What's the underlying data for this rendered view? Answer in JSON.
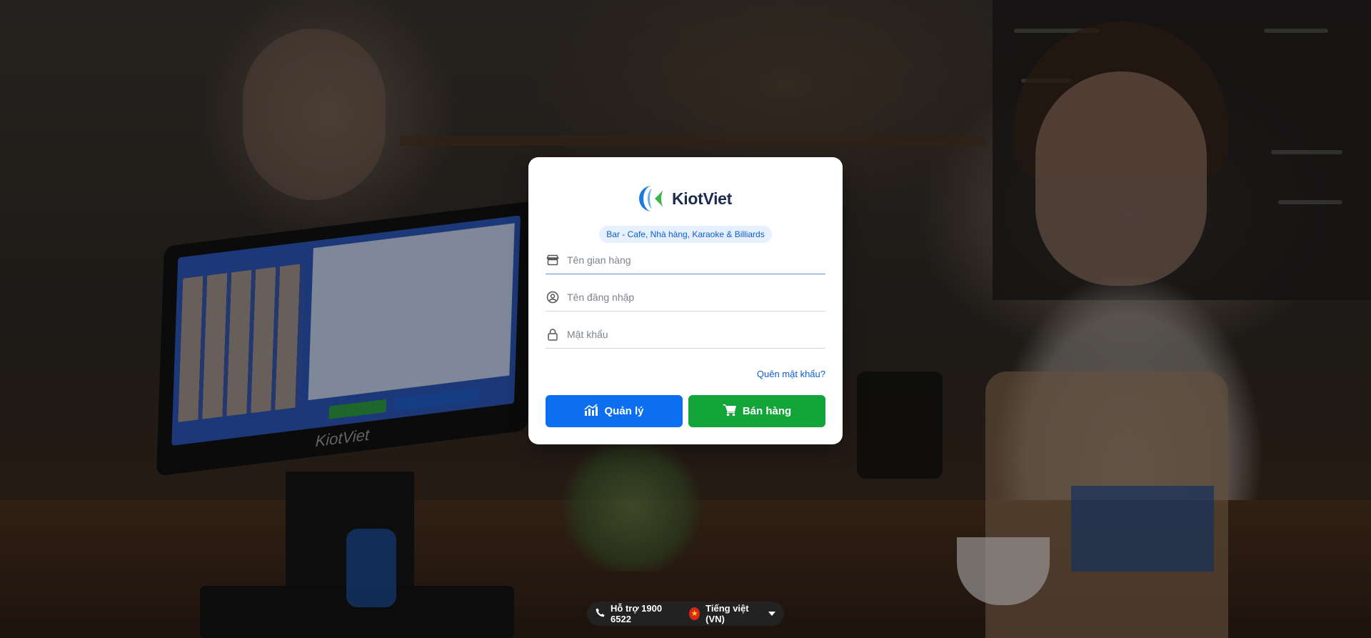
{
  "brand": {
    "name": "KiotViet",
    "tagline": "Bar - Cafe, Nhà hàng, Karaoke & Billiards"
  },
  "form": {
    "store_name_placeholder": "Tên gian hàng",
    "username_placeholder": "Tên đăng nhập",
    "password_placeholder": "Mật khẩu",
    "forgot_label": "Quên mật khẩu?"
  },
  "buttons": {
    "manage_label": "Quản lý",
    "sell_label": "Bán hàng"
  },
  "footer": {
    "support_label": "Hỗ trợ 1900 6522",
    "language_label": "Tiếng việt (VN)"
  },
  "background_brand": "KiotViet",
  "colors": {
    "primary": "#0b6ff0",
    "success": "#14a53a",
    "logo_blue": "#1b7be0",
    "logo_green": "#3cb44a",
    "text_dark": "#1b2a4e"
  },
  "icons": [
    "store-icon",
    "user-circle-icon",
    "lock-icon",
    "chart-icon",
    "cart-icon",
    "phone-icon",
    "vn-flag-icon",
    "caret-down-icon"
  ]
}
